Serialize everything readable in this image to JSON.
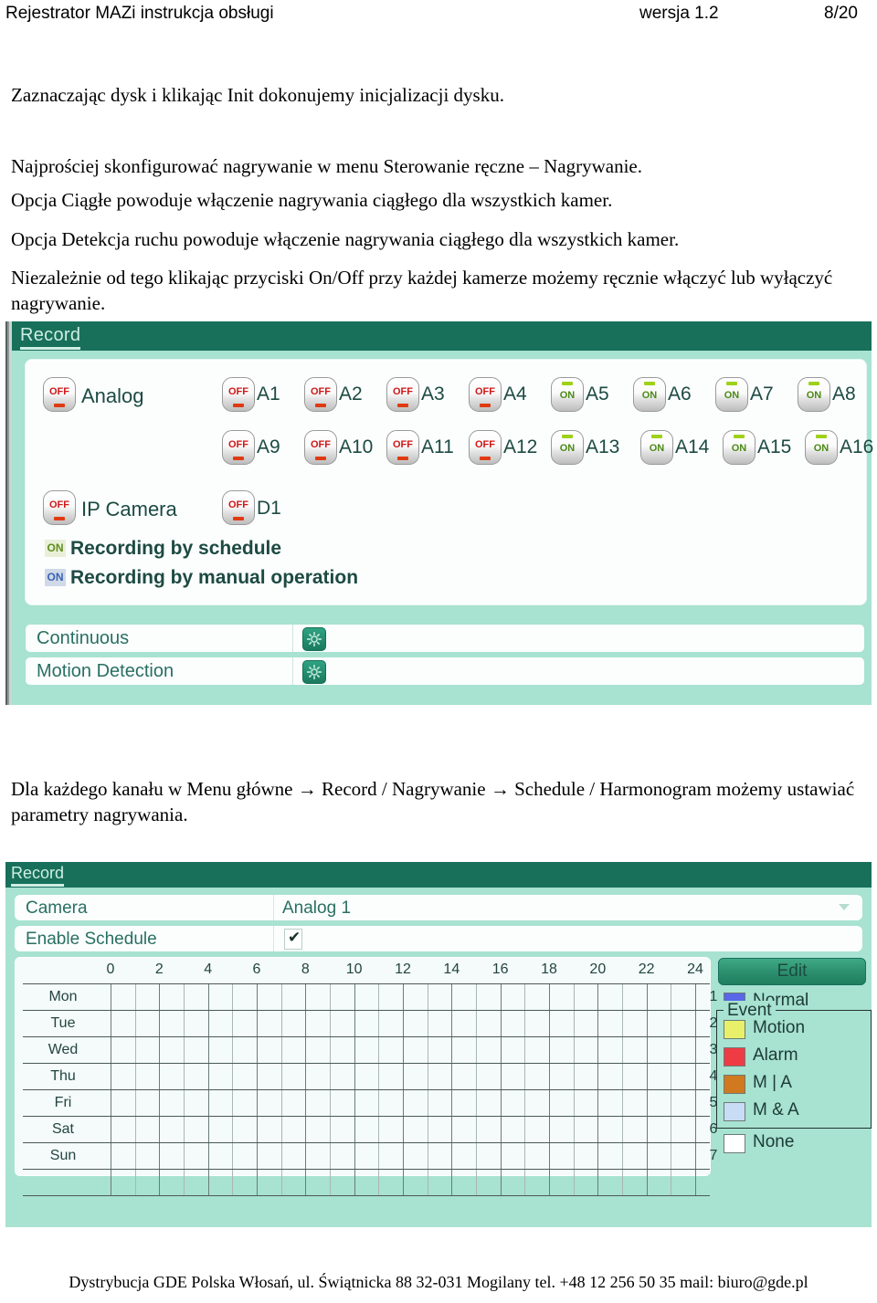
{
  "header": {
    "left": "Rejestrator MAZi instrukcja obsługi",
    "version": "wersja 1.2",
    "page": "8/20"
  },
  "paragraphs": [
    "Zaznaczając dysk i klikając Init dokonujemy inicjalizacji dysku.",
    "Najprościej skonfigurować nagrywanie w menu Sterowanie ręczne – Nagrywanie.",
    "Opcja Ciągłe powoduje włączenie nagrywania ciągłego dla wszystkich kamer.",
    "Opcja Detekcja ruchu powoduje włączenie nagrywania ciągłego dla wszystkich kamer.",
    "Niezależnie od tego klikając przyciski On/Off przy każdej kamerze możemy  ręcznie włączyć lub wyłączyć nagrywanie."
  ],
  "mid_paragraph": "Dla każdego kanału w Menu główne → Record / Nagrywanie → Schedule / Harmonogram możemy ustawiać parametry nagrywania.",
  "footer": "Dystrybucja GDE Polska    Włosań, ul. Świątnicka 88 32-031 Mogilany    tel. +48 12 256 50 35 mail: biuro@gde.pl",
  "screenshot_manual": {
    "title": "Record",
    "master_analog": {
      "state": "OFF",
      "label": "Analog"
    },
    "analog_channels": [
      {
        "label": "A1",
        "state": "OFF"
      },
      {
        "label": "A2",
        "state": "OFF"
      },
      {
        "label": "A3",
        "state": "OFF"
      },
      {
        "label": "A4",
        "state": "OFF"
      },
      {
        "label": "A5",
        "state": "ON"
      },
      {
        "label": "A6",
        "state": "ON"
      },
      {
        "label": "A7",
        "state": "ON"
      },
      {
        "label": "A8",
        "state": "ON"
      },
      {
        "label": "A9",
        "state": "OFF"
      },
      {
        "label": "A10",
        "state": "OFF"
      },
      {
        "label": "A11",
        "state": "OFF"
      },
      {
        "label": "A12",
        "state": "OFF"
      },
      {
        "label": "A13",
        "state": "ON"
      },
      {
        "label": "A14",
        "state": "ON"
      },
      {
        "label": "A15",
        "state": "ON"
      },
      {
        "label": "A16",
        "state": "ON"
      }
    ],
    "master_ip": {
      "state": "OFF",
      "label": "IP Camera"
    },
    "ip_channels": [
      {
        "label": "D1",
        "state": "OFF"
      }
    ],
    "legend": [
      {
        "badge": "ON",
        "text": "Recording by schedule",
        "color": "#5f8d1e"
      },
      {
        "badge": "ON",
        "text": "Recording by manual operation",
        "color": "#3b62b4"
      }
    ],
    "options": [
      {
        "label": "Continuous",
        "icon": "gear-icon"
      },
      {
        "label": "Motion Detection",
        "icon": "gear-icon"
      }
    ]
  },
  "screenshot_schedule": {
    "title": "Record",
    "camera_row": {
      "label": "Camera",
      "value": "Analog 1"
    },
    "enable_row": {
      "label": "Enable Schedule",
      "checked": "✔"
    },
    "hours": [
      "0",
      "2",
      "4",
      "6",
      "8",
      "10",
      "12",
      "14",
      "16",
      "18",
      "20",
      "22",
      "24"
    ],
    "days": [
      {
        "name": "Mon",
        "num": "1"
      },
      {
        "name": "Tue",
        "num": "2"
      },
      {
        "name": "Wed",
        "num": "3"
      },
      {
        "name": "Thu",
        "num": "4"
      },
      {
        "name": "Fri",
        "num": "5"
      },
      {
        "name": "Sat",
        "num": "6"
      },
      {
        "name": "Sun",
        "num": "7"
      }
    ],
    "edit_label": "Edit",
    "legend_normal": {
      "label": "Normal",
      "color": "#5866e8"
    },
    "event_caption": "Event",
    "legend_events": [
      {
        "label": "Motion",
        "color": "#e8f06a"
      },
      {
        "label": "Alarm",
        "color": "#ef3b44"
      },
      {
        "label": "M | A",
        "color": "#d1791f"
      },
      {
        "label": "M & A",
        "color": "#c9dcf5"
      }
    ],
    "legend_none": {
      "label": "None",
      "color": "#ffffff"
    }
  }
}
